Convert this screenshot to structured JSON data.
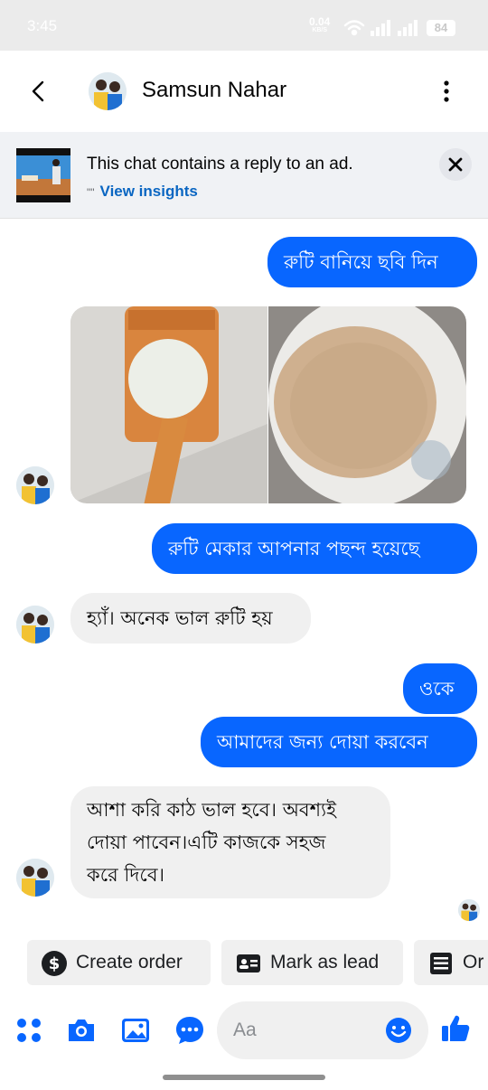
{
  "status_bar": {
    "time": "3:45",
    "net_speed": "0.04",
    "net_unit": "KB/S",
    "battery": "84"
  },
  "header": {
    "contact_name": "Samsun Nahar"
  },
  "ad_banner": {
    "title": "This chat contains a reply to an ad.",
    "quote_mark": "\"\"",
    "link": "View insights"
  },
  "messages": [
    {
      "side": "out",
      "text": "রুটি বানিয়ে ছবি দিন"
    },
    {
      "side": "in",
      "type": "photos"
    },
    {
      "side": "out",
      "text": "রুটি মেকার আপনার পছন্দ হয়েছে"
    },
    {
      "side": "in",
      "text": "হ্যাঁ। অনেক ভাল রুটি হয়"
    },
    {
      "side": "out",
      "text": "ওকে"
    },
    {
      "side": "out",
      "text": "আমাদের জন্য দোয়া করবেন"
    },
    {
      "side": "in",
      "lines": [
        "আশা করি কাঠ ভাল হবে। অবশ্যই",
        "দোয়া পাবেন।এটি কাজকে সহজ",
        "করে দিবে।"
      ]
    }
  ],
  "quick_actions": [
    {
      "label": "Create order",
      "icon": "dollar-icon"
    },
    {
      "label": "Mark as lead",
      "icon": "contact-card-icon"
    },
    {
      "label": "Or",
      "icon": "list-icon"
    }
  ],
  "composer": {
    "placeholder": "Aa"
  },
  "colors": {
    "accent": "#0866ff",
    "link": "#0a66c2",
    "incoming_bubble": "#f0f0f0"
  }
}
